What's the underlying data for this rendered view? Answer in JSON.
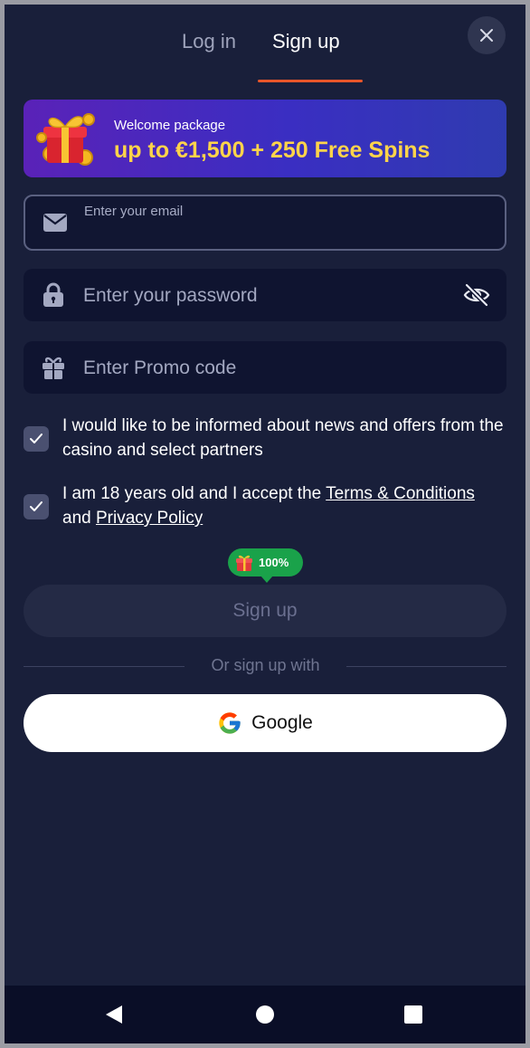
{
  "tabs": {
    "login": "Log in",
    "signup": "Sign up",
    "active": "signup"
  },
  "banner": {
    "subtitle": "Welcome package",
    "headline": "up to €1,500 + 250 Free Spins"
  },
  "form": {
    "email": {
      "label": "Enter your email",
      "value": ""
    },
    "password": {
      "placeholder": "Enter your password",
      "value": ""
    },
    "promo": {
      "placeholder": "Enter Promo code",
      "value": ""
    }
  },
  "consents": {
    "news": {
      "checked": true,
      "text": "I would like to be informed about news and offers from the casino and select partners"
    },
    "age": {
      "checked": true,
      "prefix": "I am 18 years old and I accept the",
      "terms_link": "Terms & Conditions",
      "joiner": "and",
      "privacy_link": "Privacy Policy"
    }
  },
  "bonus_badge": {
    "text": "100%"
  },
  "submit": {
    "label": "Sign up",
    "enabled": false
  },
  "divider": {
    "text": "Or sign up with"
  },
  "social": {
    "google_label": "Google"
  },
  "colors": {
    "background": "#191f3a",
    "accent_underline": "#e8562a",
    "banner_headline": "#ffd44a",
    "badge_green": "#1aa24a",
    "input_bg": "#0f1430"
  },
  "icons": {
    "close": "close-icon",
    "email": "envelope-icon",
    "password": "lock-icon",
    "visibility": "eye-off-icon",
    "promo": "gift-icon",
    "check": "checkmark-icon",
    "google": "google-logo-icon"
  }
}
